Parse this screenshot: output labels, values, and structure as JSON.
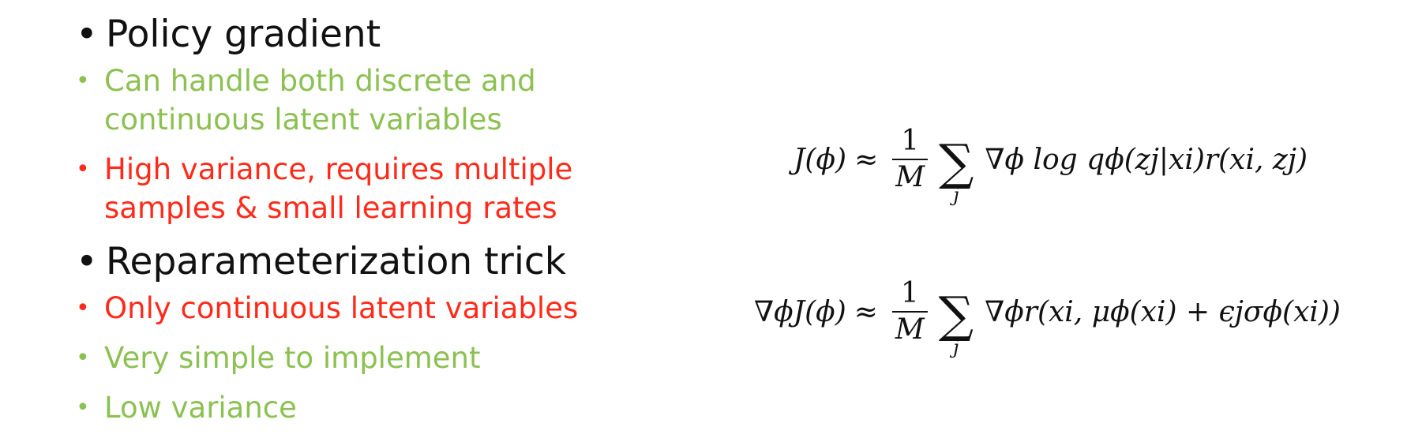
{
  "bullets": [
    {
      "title": "Policy gradient",
      "items": [
        {
          "text": "Can handle both discrete and\ncontinuous latent variables",
          "kind": "pro"
        },
        {
          "text": "High variance, requires multiple\nsamples & small learning rates",
          "kind": "con"
        }
      ]
    },
    {
      "title": "Reparameterization trick",
      "items": [
        {
          "text": "Only continuous latent variables",
          "kind": "con"
        },
        {
          "text": "Very simple to implement",
          "kind": "pro"
        },
        {
          "text": "Low variance",
          "kind": "pro"
        }
      ]
    }
  ],
  "colors": {
    "pro": "#8cc152",
    "con": "#ff2a1a",
    "text": "#111111"
  },
  "equations": {
    "eq1": {
      "lhs": "J(ϕ)",
      "approx": "≈",
      "frac_num": "1",
      "frac_den": "M",
      "sum_index": "j",
      "rhs": "∇ϕ log qϕ(zj|xi)r(xi, zj)"
    },
    "eq2": {
      "lhs": "∇ϕJ(ϕ)",
      "approx": "≈",
      "frac_num": "1",
      "frac_den": "M",
      "sum_index": "j",
      "rhs": "∇ϕr(xi, μϕ(xi) + ϵjσϕ(xi))"
    }
  }
}
